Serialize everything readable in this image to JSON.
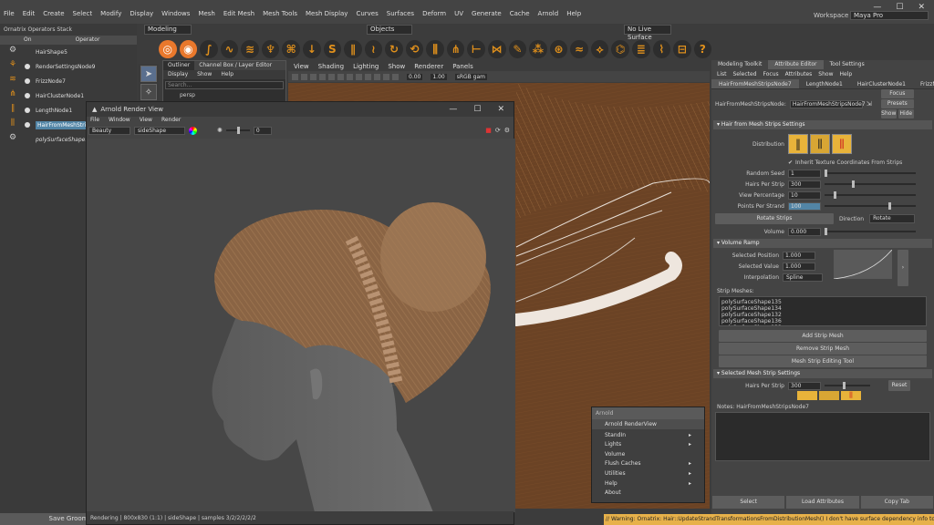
{
  "menubar": [
    "File",
    "Edit",
    "Create",
    "Select",
    "Modify",
    "Display",
    "Windows",
    "Mesh",
    "Edit Mesh",
    "Mesh Tools",
    "Mesh Display",
    "Curves",
    "Surfaces",
    "Deform",
    "UV",
    "Generate",
    "Cache",
    "Arnold",
    "Help"
  ],
  "workspace": {
    "label": "Workspace :",
    "value": "Maya Pro"
  },
  "status": {
    "mode": "Modeling",
    "objects": "Objects",
    "live": "No Live Surface"
  },
  "ornatrix": {
    "title": "Ornatrix Operators Stack",
    "col_on": "On",
    "col_op": "Operator",
    "items": [
      {
        "label": "HairShape5",
        "icon": "hair-shape-icon"
      },
      {
        "label": "RenderSettingsNode9",
        "icon": "render-settings-icon"
      },
      {
        "label": "FrizzNode7",
        "icon": "frizz-icon"
      },
      {
        "label": "HairClusterNode1",
        "icon": "cluster-icon"
      },
      {
        "label": "LengthNode1",
        "icon": "length-icon"
      },
      {
        "label": "HairFromMeshStrip",
        "icon": "mesh-strip-icon"
      },
      {
        "label": "polySurfaceShape1",
        "icon": "settings-icon"
      }
    ],
    "save": "Save Groom"
  },
  "outliner": {
    "tabs": [
      "Outliner",
      "Channel Box / Layer Editor"
    ],
    "menu": [
      "Display",
      "Show",
      "Help"
    ],
    "search": "Search...",
    "item": "persp"
  },
  "viewport": {
    "menu": [
      "View",
      "Shading",
      "Lighting",
      "Show",
      "Renderer",
      "Panels"
    ],
    "v1": "0.00",
    "v2": "1.00",
    "cs": "sRGB gam"
  },
  "render": {
    "title": "Arnold Render View",
    "menu": [
      "File",
      "Window",
      "View",
      "Render"
    ],
    "aov": "Beauty",
    "camera": "sideShape",
    "exposure": "0",
    "status": "Rendering | 800x830 (1:1) | sideShape | samples 3/2/2/2/2/2"
  },
  "ae": {
    "tabs": [
      "Modeling Toolkit",
      "Attribute Editor",
      "Tool Settings"
    ],
    "menu": [
      "List",
      "Selected",
      "Focus",
      "Attributes",
      "Show",
      "Help"
    ],
    "node_tabs": [
      "HairFromMeshStripsNode7",
      "LengthNode1",
      "HairClusterNode1",
      "FrizzN"
    ],
    "node_label": "HairFromMeshStripsNode:",
    "node_value": "HairFromMeshStripsNode7",
    "focus": "Focus",
    "presets": "Presets",
    "show": "Show",
    "hide": "Hide",
    "section1": "Hair from Mesh Strips Settings",
    "distribution": "Distribution",
    "inherit": "Inherit Texture Coordinates From Strips",
    "random_seed": {
      "k": "Random Seed",
      "v": "1"
    },
    "hairs_per_strip": {
      "k": "Hairs Per Strip",
      "v": "300"
    },
    "view_pct": {
      "k": "View Percentage",
      "v": "10"
    },
    "points": {
      "k": "Points Per Strand",
      "v": "100"
    },
    "rotate": "Rotate Strips",
    "direction_k": "Direction",
    "direction_v": "Rotate",
    "volume": {
      "k": "Volume",
      "v": "0.000"
    },
    "section2": "Volume Ramp",
    "sel_pos": {
      "k": "Selected Position",
      "v": "1.000"
    },
    "sel_val": {
      "k": "Selected Value",
      "v": "1.000"
    },
    "interp": {
      "k": "Interpolation",
      "v": "Spline"
    },
    "strip_meshes": "Strip Meshes:",
    "strips": [
      "polySurfaceShape135",
      "polySurfaceShape134",
      "polySurfaceShape132",
      "polySurfaceShape136",
      "polySurfaceShape133"
    ],
    "add": "Add Strip Mesh",
    "remove": "Remove Strip Mesh",
    "editing": "Mesh Strip Editing Tool",
    "section3": "Selected Mesh Strip Settings",
    "sel_hairs": {
      "k": "Hairs Per Strip",
      "v": "300"
    },
    "reset": "Reset",
    "notes": "Notes:  HairFromMeshStripsNode7",
    "bottom": [
      "Select",
      "Load Attributes",
      "Copy Tab"
    ]
  },
  "arnold": {
    "header": "Arnold",
    "items": [
      "Arnold RenderView",
      "StandIn",
      "Lights",
      "Volume",
      "Flush Caches",
      "Utilities",
      "Help",
      "About"
    ]
  },
  "warning": "// Warning: Ornatrix: Hair::UpdateStrandTransformationsFromDistributionMesh() I don't have surface dependency info to wo",
  "colors": {
    "accent": "#e9782c",
    "select": "#5285a6",
    "hair": "#8a5a33",
    "warn": "#e7b14a"
  }
}
